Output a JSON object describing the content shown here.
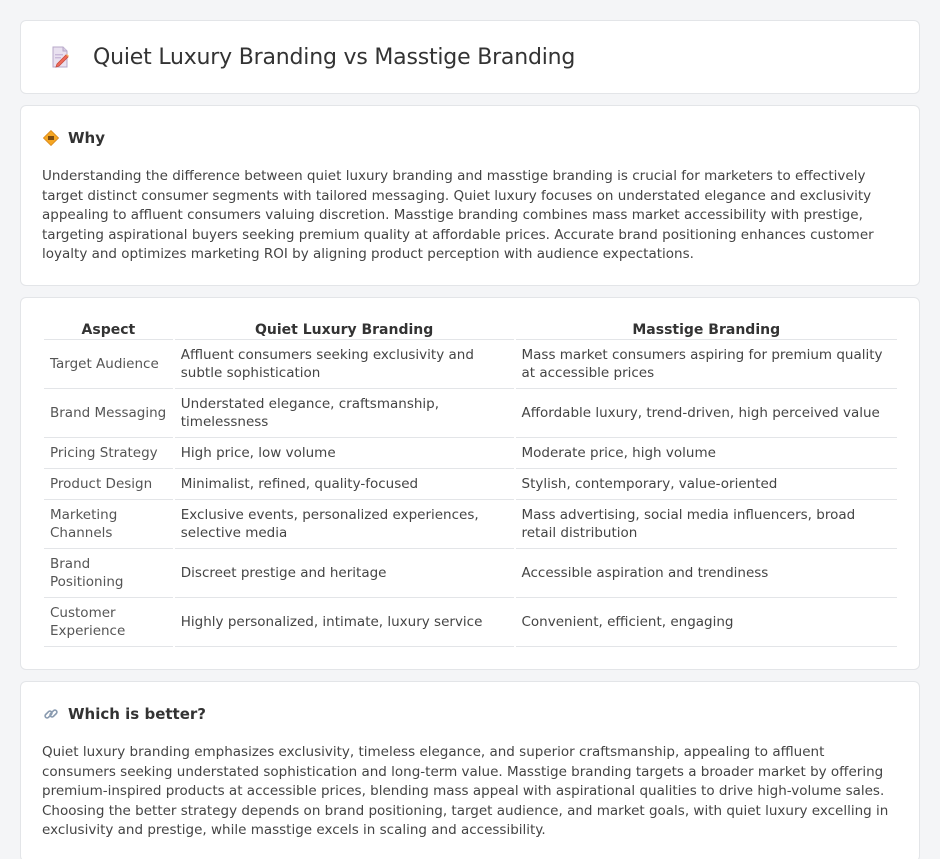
{
  "header": {
    "title": "Quiet Luxury Branding vs Masstige Branding",
    "icon": "document-pencil-icon"
  },
  "why": {
    "icon": "diamond-sign-icon",
    "title": "Why",
    "text": "Understanding the difference between quiet luxury branding and masstige branding is crucial for marketers to effectively target distinct consumer segments with tailored messaging. Quiet luxury focuses on understated elegance and exclusivity appealing to affluent consumers valuing discretion. Masstige branding combines mass market accessibility with prestige, targeting aspirational buyers seeking premium quality at affordable prices. Accurate brand positioning enhances customer loyalty and optimizes marketing ROI by aligning product perception with audience expectations."
  },
  "table": {
    "headers": [
      "Aspect",
      "Quiet Luxury Branding",
      "Masstige Branding"
    ],
    "rows": [
      [
        "Target Audience",
        "Affluent consumers seeking exclusivity and subtle sophistication",
        "Mass market consumers aspiring for premium quality at accessible prices"
      ],
      [
        "Brand Messaging",
        "Understated elegance, craftsmanship, timelessness",
        "Affordable luxury, trend-driven, high perceived value"
      ],
      [
        "Pricing Strategy",
        "High price, low volume",
        "Moderate price, high volume"
      ],
      [
        "Product Design",
        "Minimalist, refined, quality-focused",
        "Stylish, contemporary, value-oriented"
      ],
      [
        "Marketing Channels",
        "Exclusive events, personalized experiences, selective media",
        "Mass advertising, social media influencers, broad retail distribution"
      ],
      [
        "Brand Positioning",
        "Discreet prestige and heritage",
        "Accessible aspiration and trendiness"
      ],
      [
        "Customer Experience",
        "Highly personalized, intimate, luxury service",
        "Convenient, efficient, engaging"
      ]
    ]
  },
  "better": {
    "icon": "link-icon",
    "title": "Which is better?",
    "text": "Quiet luxury branding emphasizes exclusivity, timeless elegance, and superior craftsmanship, appealing to affluent consumers seeking understated sophistication and long-term value. Masstige branding targets a broader market by offering premium-inspired products at accessible prices, blending mass appeal with aspirational qualities to drive high-volume sales. Choosing the better strategy depends on brand positioning, target audience, and market goals, with quiet luxury excelling in exclusivity and prestige, while masstige excels in scaling and accessibility."
  },
  "colors": {
    "background": "#f4f5f7",
    "card": "#ffffff",
    "border": "#e3e5e8",
    "accent": "#f5a623"
  }
}
